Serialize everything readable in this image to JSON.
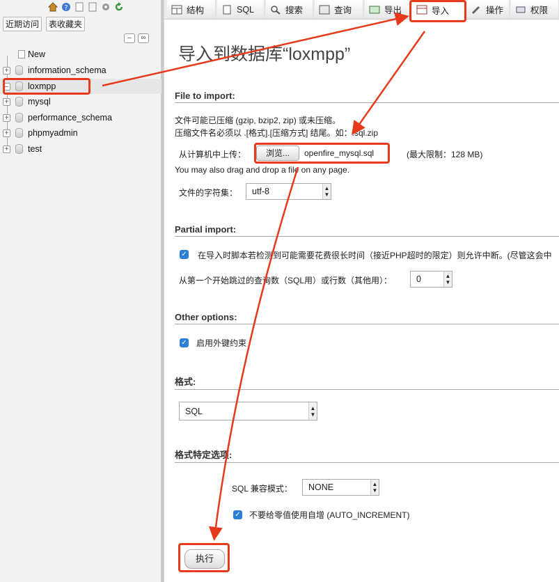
{
  "nav": {
    "recent_label": "近期访问",
    "favorites_label": "表收藏夹"
  },
  "tree": {
    "new_label": "New",
    "databases": [
      "information_schema",
      "loxmpp",
      "mysql",
      "performance_schema",
      "phpmyadmin",
      "test"
    ]
  },
  "tabs": {
    "structure": "结构",
    "sql": "SQL",
    "search": "搜索",
    "query": "查询",
    "export": "导出",
    "import": "导入",
    "operations": "操作",
    "privileges": "权限"
  },
  "page": {
    "title": "导入到数据库“loxmpp”"
  },
  "file_import": {
    "heading": "File to import:",
    "line1": "文件可能已压缩 (gzip, bzip2, zip) 或未压缩。",
    "line2": "压缩文件名必须以 .[格式].[压缩方式] 结尾。如：.sql.zip",
    "upload_label": "从计算机中上传：",
    "browse_button": "浏览...",
    "file_name": "openfire_mysql.sql",
    "max_limit": "(最大限制：128 MB)",
    "drag_note": "You may also drag and drop a file on any page.",
    "charset_label": "文件的字符集：",
    "charset_value": "utf-8"
  },
  "partial_import": {
    "heading": "Partial import:",
    "interrupt_label": "在导入时脚本若检测到可能需要花费很长时间（接近PHP超时的限定）则允许中断。(尽管这会中",
    "skip_label": "从第一个开始跳过的查询数（SQL用）或行数（其他用）：",
    "skip_value": "0"
  },
  "other_options": {
    "heading": "Other options:",
    "fk_label": "启用外键约束"
  },
  "format": {
    "heading": "格式:",
    "value": "SQL"
  },
  "format_options": {
    "heading": "格式特定选项:",
    "compat_label": "SQL 兼容模式：",
    "compat_value": "NONE",
    "auto_inc_label": "不要给零值使用自增 (AUTO_INCREMENT)"
  },
  "actions": {
    "go_button": "执行"
  },
  "colors": {
    "annotation": "#e63a1a",
    "checkbox": "#2b7fd6"
  }
}
